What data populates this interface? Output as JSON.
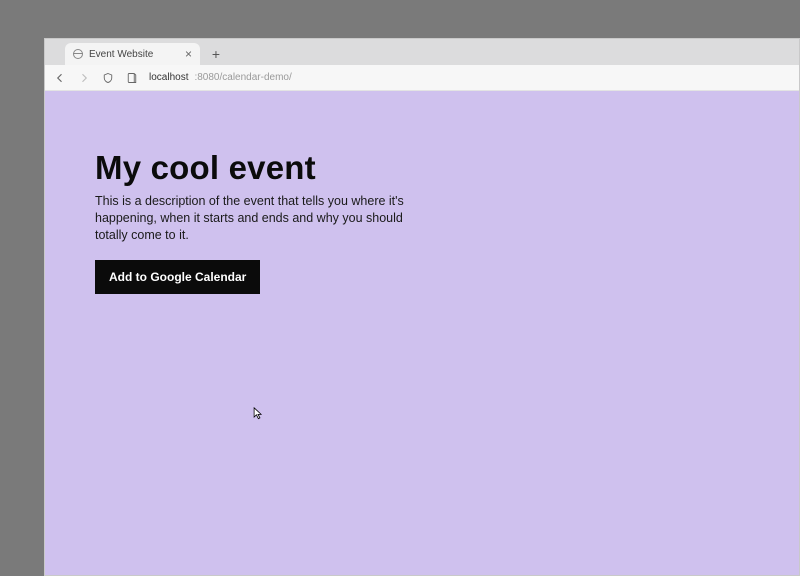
{
  "browser": {
    "tab": {
      "title": "Event Website",
      "close_glyph": "×"
    },
    "new_tab_glyph": "+",
    "url": {
      "host": "localhost",
      "port_and_path": ":8080/calendar-demo/"
    }
  },
  "page": {
    "title": "My cool event",
    "description": "This is a description of the event that tells you where it's happening, when it starts and ends and why you should totally come to it.",
    "cta_label": "Add to Google Calendar"
  }
}
